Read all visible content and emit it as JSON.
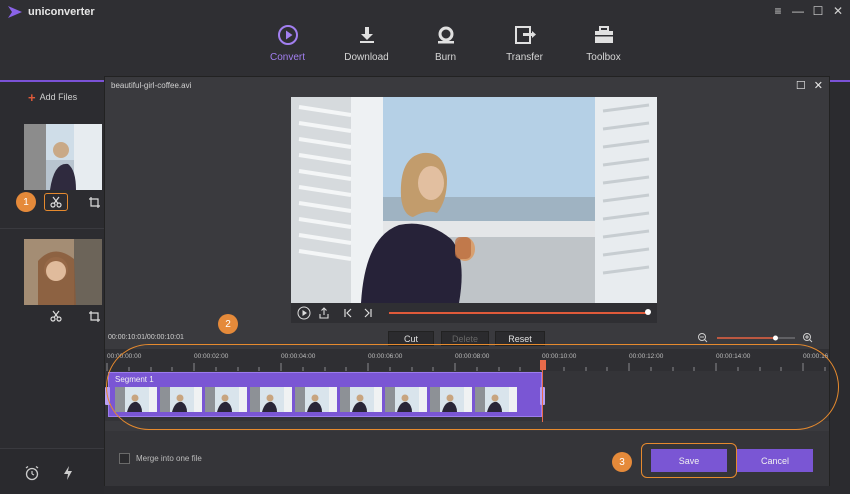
{
  "app": {
    "name": "uniconverter"
  },
  "window_controls": [
    "≡",
    "—",
    "☐",
    "✕"
  ],
  "nav": [
    {
      "label": "Convert",
      "icon": "convert-icon",
      "active": true
    },
    {
      "label": "Download",
      "icon": "download-icon",
      "active": false
    },
    {
      "label": "Burn",
      "icon": "burn-icon",
      "active": false
    },
    {
      "label": "Transfer",
      "icon": "transfer-icon",
      "active": false
    },
    {
      "label": "Toolbox",
      "icon": "toolbox-icon",
      "active": false
    }
  ],
  "sidebar": {
    "add_files_label": "Add Files"
  },
  "dialog": {
    "title": "beautiful-girl-coffee.avi",
    "timecode": "00:00:10:01/00:00:10:01",
    "cut_label": "Cut",
    "delete_label": "Delete",
    "reset_label": "Reset",
    "ruler_labels": [
      "00:00:00:00",
      "00:00:02:00",
      "00:00:04:00",
      "00:00:06:00",
      "00:00:08:00",
      "00:00:10:00",
      "00:00:12:00",
      "00:00:14:00",
      "00:00:16"
    ],
    "segment_label": "Segment 1",
    "merge_label": "Merge into one file",
    "save_label": "Save",
    "cancel_label": "Cancel",
    "playback_progress": 1.0,
    "zoom_level": 0.75
  },
  "markers": [
    "1",
    "2",
    "3"
  ],
  "colors": {
    "accent": "#7a56d4",
    "highlight": "#e68a2e",
    "playhead": "#e86a4a"
  }
}
